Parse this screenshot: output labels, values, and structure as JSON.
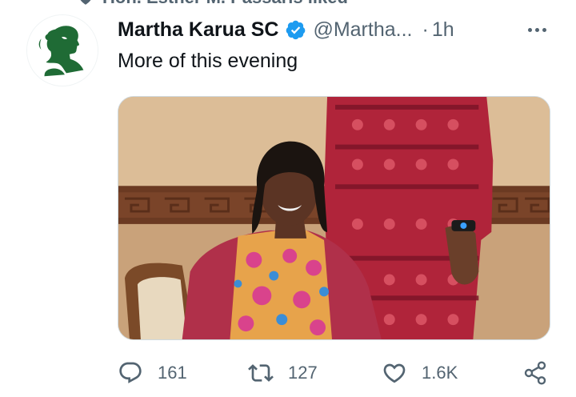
{
  "social_context": {
    "text": "Hon. Esther M. Passaris liked",
    "icon": "heart-filled-icon"
  },
  "author": {
    "display_name": "Martha Karua SC",
    "verified": true,
    "handle": "@Martha...",
    "separator": "·",
    "time": "1h",
    "avatar_icon": "portrait-silhouette-logo"
  },
  "tweet": {
    "text": "More of this evening",
    "media_alt": "Photo of a smiling woman in a colorful patterned outfit seated in a wooden chair, with a person in a red patterned dress standing beside her"
  },
  "actions": {
    "reply": {
      "icon": "reply-icon",
      "count": "161"
    },
    "retweet": {
      "icon": "retweet-icon",
      "count": "127"
    },
    "like": {
      "icon": "like-icon",
      "count": "1.6K"
    },
    "share": {
      "icon": "share-icon"
    }
  },
  "menu": {
    "icon": "more-options-icon"
  },
  "colors": {
    "text_primary": "#0f1419",
    "text_secondary": "#536471",
    "verified_blue": "#1d9bf0",
    "avatar_green": "#1f6b35",
    "border": "#cfd9de"
  }
}
